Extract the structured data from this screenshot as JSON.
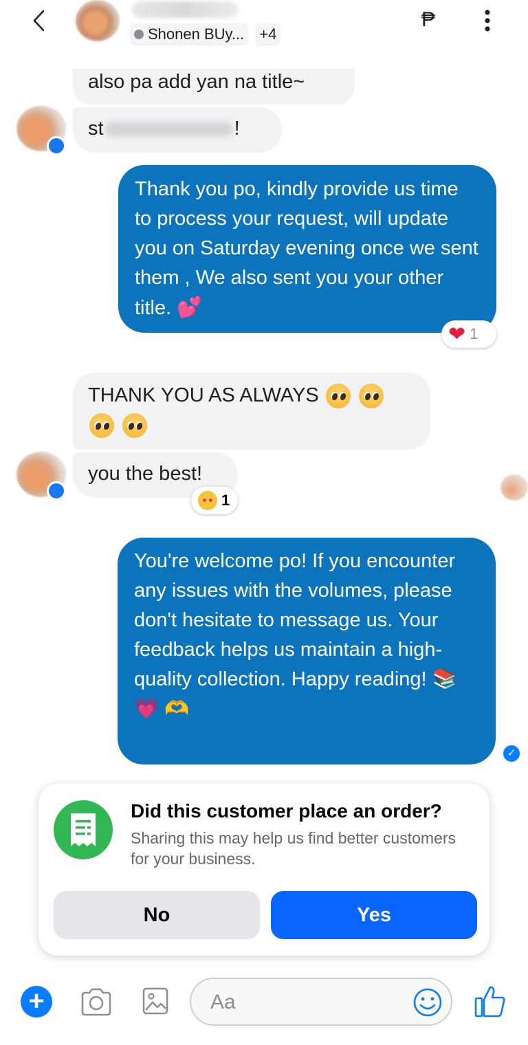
{
  "header": {
    "group_label": "Shonen BUy...",
    "extra_count": "+4",
    "currency_symbol": "₱"
  },
  "messages": {
    "m1": "also pa add yan na title~",
    "m2_start": "st",
    "m2_end": "!",
    "m3": "Thank you po, kindly provide us time to process your request, will update you on Saturday evening once we sent them , We also sent you your other title.",
    "m3_emoji": "💕",
    "m4": "THANK YOU AS ALWAYS",
    "m5": "you the best!",
    "m6": "You're welcome po! If you encounter any issues with the volumes, please don't hesitate to message us. Your feedback helps us maintain a high-quality collection. Happy reading!",
    "m6_emoji": "📚 💗 🫶"
  },
  "reactions": {
    "r1_emoji": "❤",
    "r1_count": "1",
    "r2_count": "1"
  },
  "order_prompt": {
    "title": "Did this customer place an order?",
    "subtitle": "Sharing this may help us find better customers for your business.",
    "no_label": "No",
    "yes_label": "Yes"
  },
  "composer": {
    "placeholder": "Aa"
  },
  "colors": {
    "outgoing_bubble": "#0c74bd",
    "incoming_bubble": "#f1f2f4",
    "accent": "#0866ff",
    "order_icon": "#31b754"
  },
  "icons": {
    "back": "chevron-left-icon",
    "more": "more-vertical-icon",
    "plus": "plus-icon",
    "camera": "camera-icon",
    "gallery": "image-icon",
    "emoji": "smiley-icon",
    "like": "thumbs-up-icon",
    "order": "receipt-icon"
  }
}
